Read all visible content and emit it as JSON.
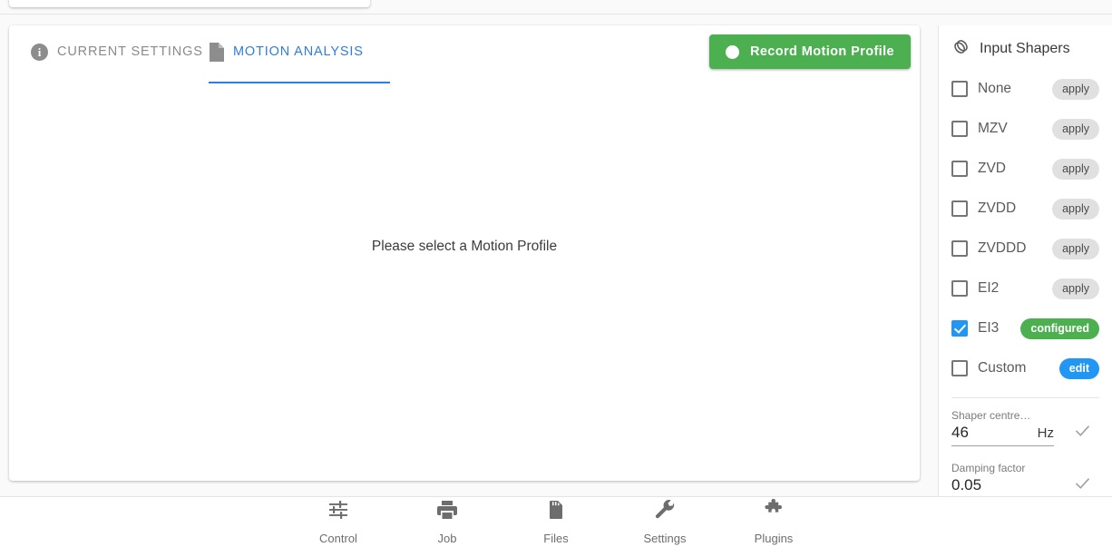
{
  "tabs": [
    {
      "label": "CURRENT SETTINGS",
      "icon": "info-icon",
      "active": false
    },
    {
      "label": "MOTION ANALYSIS",
      "icon": "document-icon",
      "active": true
    }
  ],
  "toolbar": {
    "record_label": "Record Motion Profile",
    "record_color": "#4caf50",
    "record_icon": "record-dot-icon"
  },
  "main": {
    "placeholder": "Please select a Motion Profile"
  },
  "side_panel": {
    "title": "Input Shapers",
    "title_icon": "input-shapers-icon",
    "shapers": [
      {
        "name": "None",
        "checked": false,
        "action": "apply",
        "action_style": "apply"
      },
      {
        "name": "MZV",
        "checked": false,
        "action": "apply",
        "action_style": "apply"
      },
      {
        "name": "ZVD",
        "checked": false,
        "action": "apply",
        "action_style": "apply"
      },
      {
        "name": "ZVDD",
        "checked": false,
        "action": "apply",
        "action_style": "apply"
      },
      {
        "name": "ZVDDD",
        "checked": false,
        "action": "apply",
        "action_style": "apply"
      },
      {
        "name": "EI2",
        "checked": false,
        "action": "apply",
        "action_style": "apply"
      },
      {
        "name": "EI3",
        "checked": true,
        "action": "configured",
        "action_style": "configured"
      },
      {
        "name": "Custom",
        "checked": false,
        "action": "edit",
        "action_style": "edit"
      }
    ],
    "fields": [
      {
        "label": "Shaper centre…",
        "value": "46",
        "unit": "Hz",
        "confirm_icon": "check-icon"
      },
      {
        "label": "Damping factor",
        "value": "0.05",
        "unit": "",
        "confirm_icon": "check-icon"
      }
    ]
  },
  "bottom_nav": [
    {
      "label": "Control",
      "icon": "sliders-icon"
    },
    {
      "label": "Job",
      "icon": "printer-icon"
    },
    {
      "label": "Files",
      "icon": "sd-card-icon"
    },
    {
      "label": "Settings",
      "icon": "wrench-icon"
    },
    {
      "label": "Plugins",
      "icon": "puzzle-icon"
    }
  ],
  "colors": {
    "accent_blue": "#2196f3",
    "tab_active": "#2f7ed8",
    "success_green": "#4caf50",
    "chip_grey": "#e0e0e0"
  }
}
